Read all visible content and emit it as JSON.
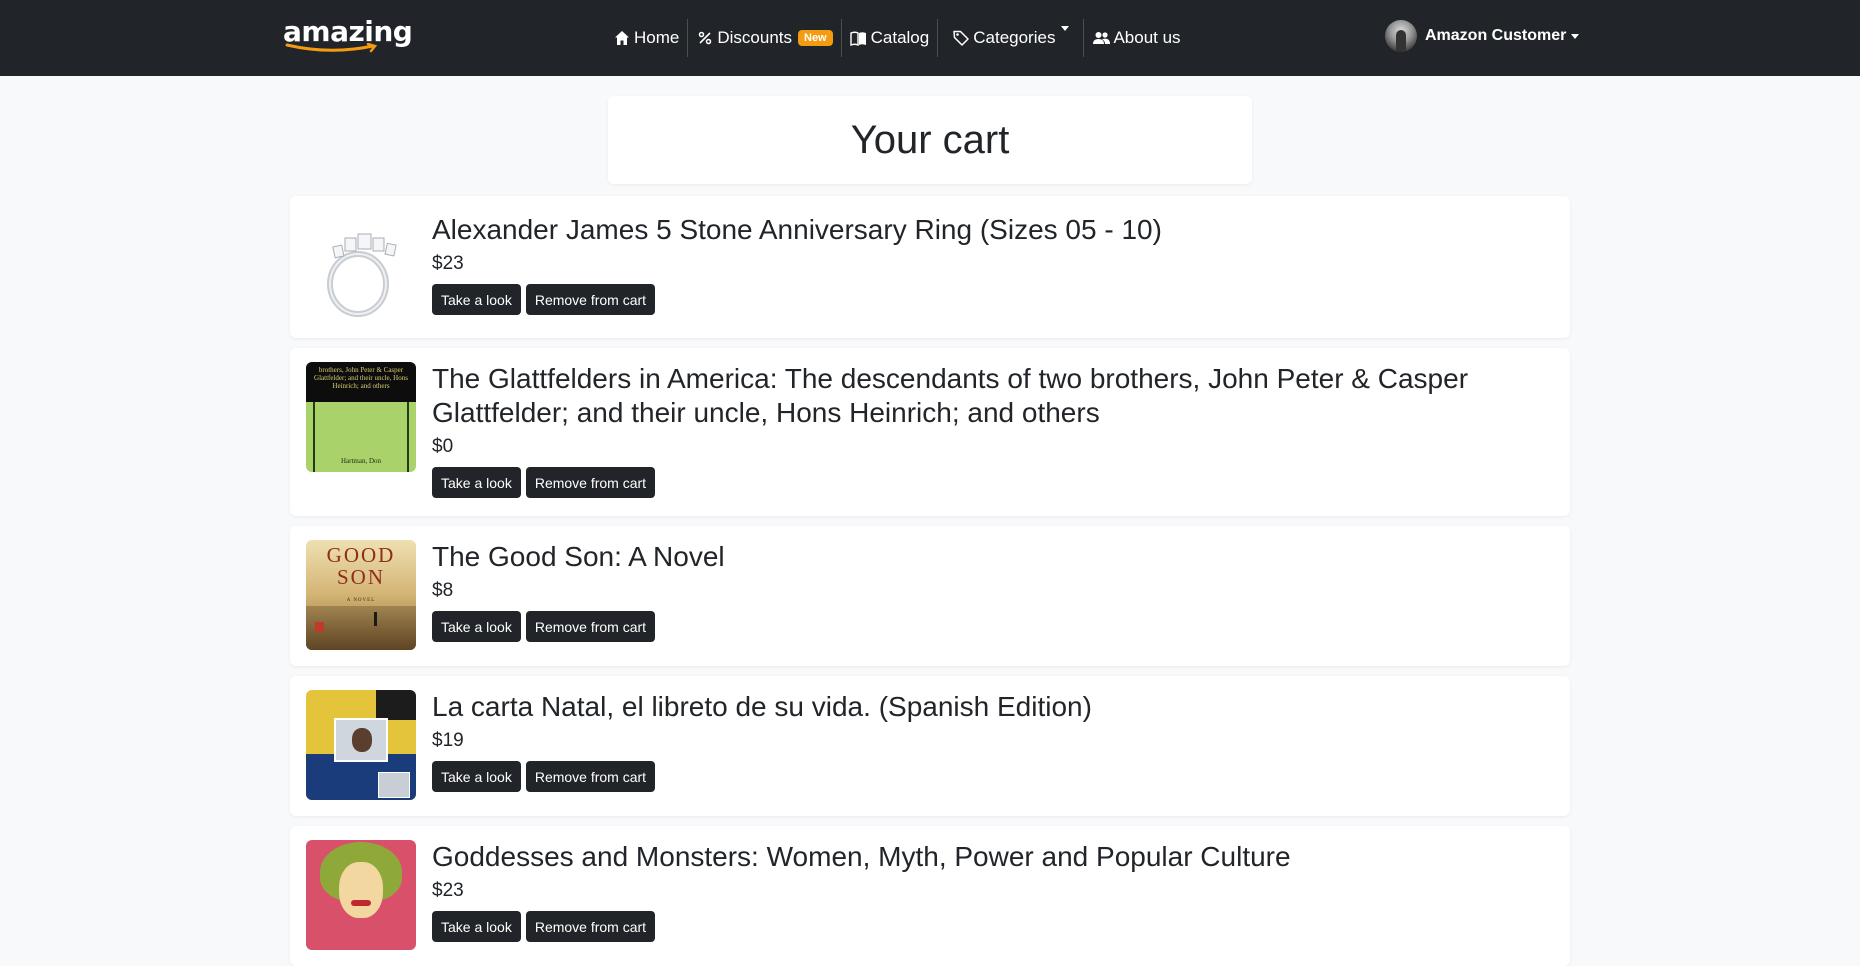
{
  "brand": {
    "logo": "amazing"
  },
  "nav": {
    "home": "Home",
    "discounts": "Discounts",
    "discounts_badge": "New",
    "catalog": "Catalog",
    "categories": "Categories",
    "about": "About us"
  },
  "user": {
    "name": "Amazon Customer"
  },
  "page_title": "Your cart",
  "buttons": {
    "look": "Take a look",
    "remove": "Remove from cart"
  },
  "items": [
    {
      "title": "Alexander James 5 Stone Anniversary Ring (Sizes 05 - 10)",
      "price": "$23"
    },
    {
      "title": "The Glattfelders in America: The descendants of two brothers, John Peter & Casper Glattfelder; and their uncle, Hons Heinrich; and others",
      "price": "$0"
    },
    {
      "title": "The Good Son: A Novel",
      "price": "$8"
    },
    {
      "title": "La carta Natal, el libreto de su vida. (Spanish Edition)",
      "price": "$19"
    },
    {
      "title": "Goddesses and Monsters: Women, Myth, Power and Popular Culture",
      "price": "$23"
    }
  ],
  "thumbs": {
    "book2_top": "brothers, John Peter & Casper Glattfelder; and their uncle, Hons Heinrich; and others",
    "book2_author": "Hartman, Don",
    "book3_title": "GOOD SON",
    "book3_sub": "A NOVEL"
  }
}
